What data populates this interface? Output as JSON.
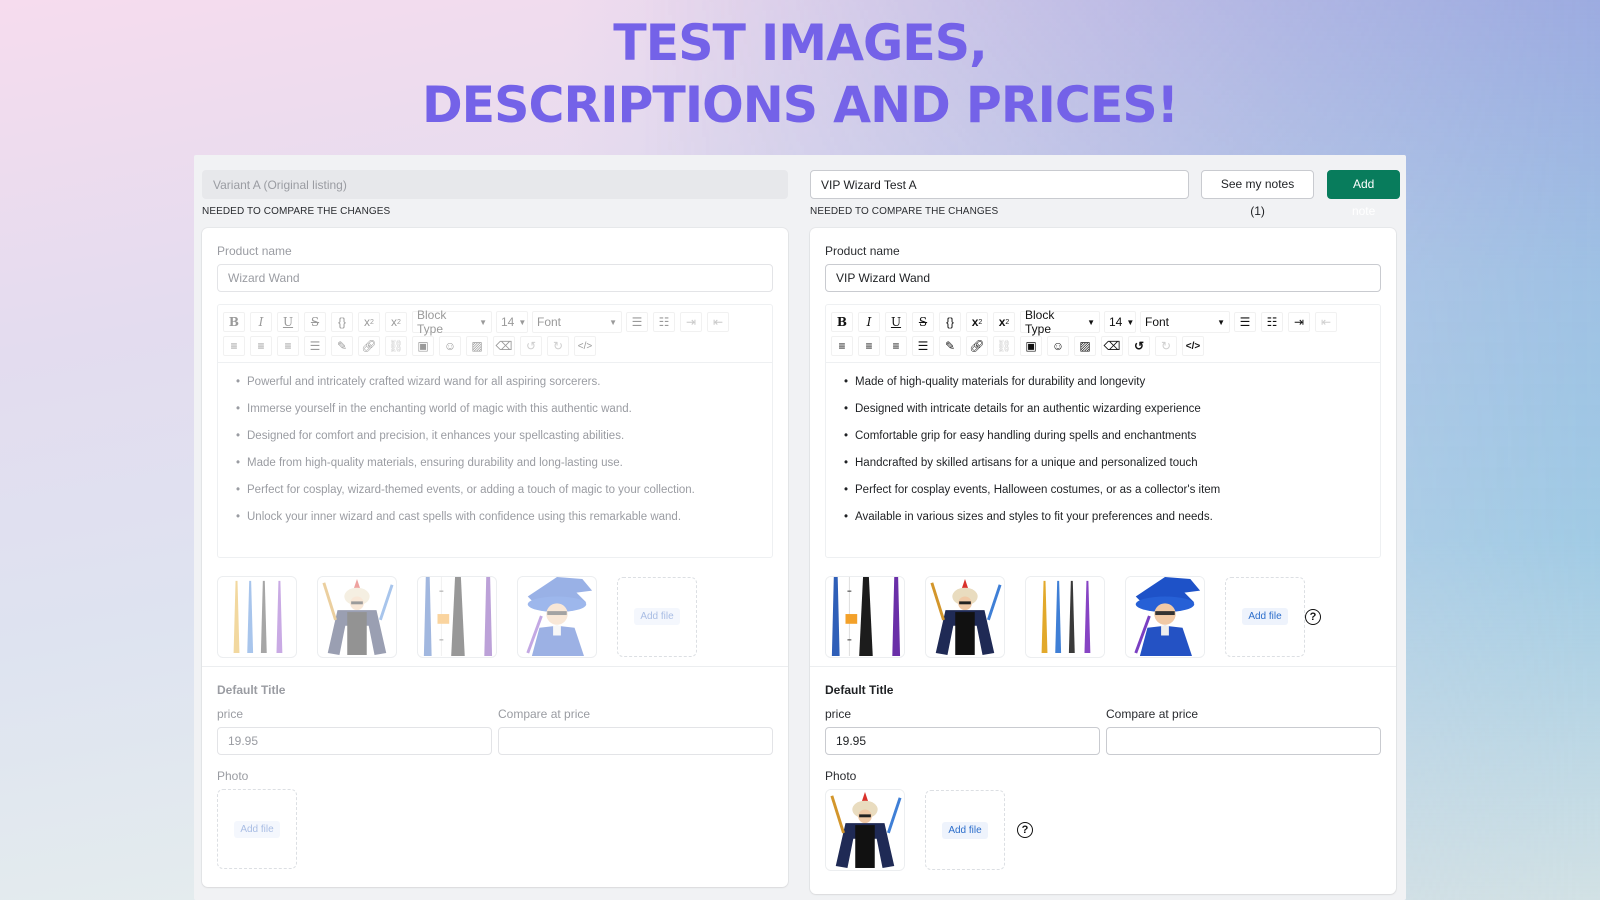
{
  "headline": {
    "line1": "TEST IMAGES,",
    "line2": "DESCRIPTIONS AND PRICES!"
  },
  "colors": {
    "headline": "#7462e8",
    "primary_button": "#087c5c",
    "link_blue": "#2c6ecb"
  },
  "original": {
    "variant_name": "Variant A (Original listing)",
    "hint": "NEEDED TO COMPARE THE CHANGES",
    "product_name_label": "Product name",
    "product_name": "Wizard Wand",
    "toolbar": {
      "block_type": "Block Type",
      "font_size": "14",
      "font": "Font"
    },
    "description": [
      "Powerful and intricately crafted wizard wand for all aspiring sorcerers.",
      "Immerse yourself in the enchanting world of magic with this authentic wand.",
      "Designed for comfort and precision, it enhances your spellcasting abilities.",
      "Made from high-quality materials, ensuring durability and long-lasting use.",
      "Perfect for cosplay, wizard-themed events, or adding a touch of magic to your collection.",
      "Unlock your inner wizard and cast spells with confidence using this remarkable wand."
    ],
    "images": [
      {
        "name": "four-colored-wands"
      },
      {
        "name": "wizard-costume-man"
      },
      {
        "name": "wands-with-ruler"
      },
      {
        "name": "boy-wizard-blue-hat"
      }
    ],
    "add_file": "Add file",
    "variant": {
      "title": "Default Title",
      "price_label": "price",
      "price": "19.95",
      "compare_label": "Compare at price",
      "compare_price": "",
      "photo_label": "Photo",
      "add_file": "Add file"
    }
  },
  "test": {
    "variant_name": "VIP Wizard Test A",
    "see_notes": "See my notes (1)",
    "add_note": "Add note",
    "hint": "NEEDED TO COMPARE THE CHANGES",
    "product_name_label": "Product name",
    "product_name": "VIP Wizard Wand",
    "toolbar": {
      "block_type": "Block Type",
      "font_size": "14",
      "font": "Font"
    },
    "description": [
      "Made of high-quality materials for durability and longevity",
      "Designed with intricate details for an authentic wizarding experience",
      "Comfortable grip for easy handling during spells and enchantments",
      "Handcrafted by skilled artisans for a unique and personalized touch",
      "Perfect for cosplay events, Halloween costumes, or as a collector's item",
      "Available in various sizes and styles to fit your preferences and needs."
    ],
    "images": [
      {
        "name": "wands-with-ruler"
      },
      {
        "name": "wizard-costume-man"
      },
      {
        "name": "four-colored-wands"
      },
      {
        "name": "boy-wizard-blue-hat"
      }
    ],
    "add_file": "Add file",
    "help": "?",
    "variant": {
      "title": "Default Title",
      "price_label": "price",
      "price": "19.95",
      "compare_label": "Compare at price",
      "compare_price": "",
      "photo_label": "Photo",
      "photo": "wizard-costume-man",
      "add_file": "Add file",
      "help": "?"
    }
  }
}
